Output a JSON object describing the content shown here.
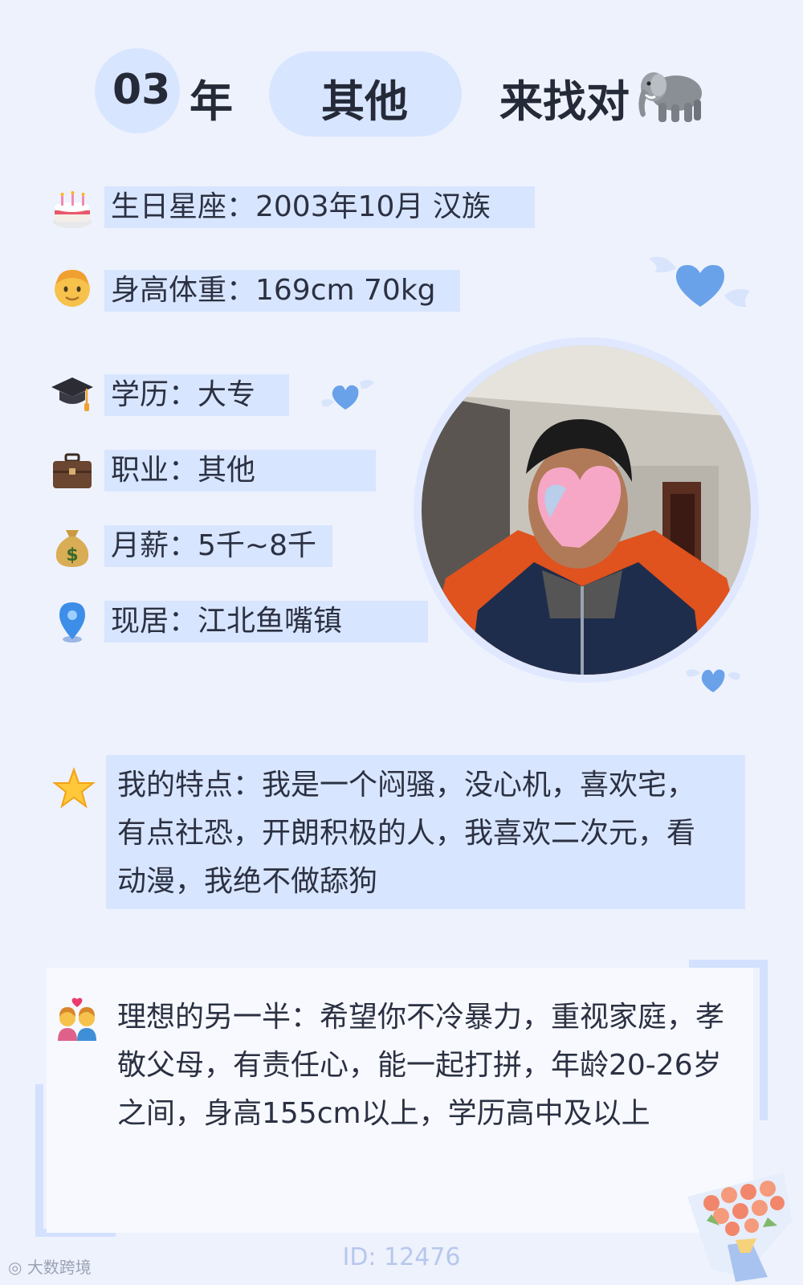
{
  "header": {
    "year_num": "03",
    "year_unit": "年",
    "job": "其他",
    "seek": "来找对",
    "mascot_icon": "elephant-icon"
  },
  "info": [
    {
      "icon": "birthday-cake-icon",
      "text": "生日星座：2003年10月 汉族"
    },
    {
      "icon": "man-face-icon",
      "text": "身高体重：169cm 70kg"
    },
    {
      "icon": "graduation-cap-icon",
      "text": "学历：大专"
    },
    {
      "icon": "briefcase-icon",
      "text": "职业：其他"
    },
    {
      "icon": "money-bag-icon",
      "text": "月薪：5千~8千"
    },
    {
      "icon": "location-pin-icon",
      "text": "现居：江北鱼嘴镇"
    }
  ],
  "traits": {
    "icon": "star-icon",
    "lines": [
      "我的特点：我是一个闷骚，没心机，喜欢宅，",
      "有点社恐，开朗积极的人，我喜欢二次元，看",
      "动漫，我绝不做舔狗"
    ]
  },
  "ideal": {
    "icon": "couple-heart-icon",
    "lines": [
      "理想的另一半：希望你不冷暴力，重视家庭，孝",
      "敬父母，有责任心，能一起打拼，年龄20-26岁",
      "之间，身高155cm以上，学历高中及以上"
    ]
  },
  "footer": {
    "id": "ID: 12476",
    "watermark": "大数跨境"
  },
  "colors": {
    "background": "#eef2fd",
    "accent": "#d8e5ff",
    "heart": "#6aa2ea",
    "text": "#2b3142"
  }
}
